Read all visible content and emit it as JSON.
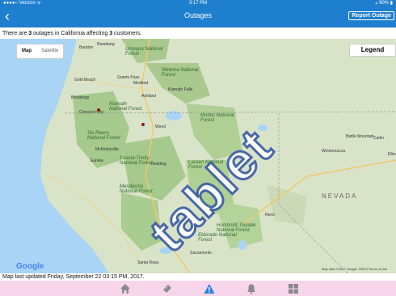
{
  "status": {
    "carrier": "●●●●○ Verizon ᯤ",
    "time": "3:17 PM",
    "battery": "⁎ 90% ▮"
  },
  "nav": {
    "title": "Outages",
    "report_label": "Report Outage"
  },
  "summary": {
    "prefix": "There are ",
    "outages": "3",
    "middle": " outages in California affecting ",
    "customers": "3",
    "suffix": " customers."
  },
  "map": {
    "map_label": "Map",
    "satellite_label": "Satellite",
    "legend_label": "Legend",
    "google_label": "Google",
    "attribution": "Map data ©2017 Google, INEGI   Terms of Use",
    "places": [
      "Roseburg",
      "Bandon",
      "Gold Beach",
      "Grants Pass",
      "Medford",
      "Brookings",
      "Ashland",
      "Klamath Falls",
      "Crescent City",
      "Weed",
      "McKinleyville",
      "Eureka",
      "Redding",
      "Reno",
      "Sacramento",
      "Santa Rosa",
      "Winnemucca",
      "Battle Mountain",
      "Carlin",
      "Elko"
    ],
    "forests": [
      "Umpqua National Forest",
      "Winema National Forest",
      "Klamath National Forest",
      "Six Rivers National Forest",
      "Modoc National Forest",
      "Shasta-Trinity National Forest",
      "Lassen National Forest",
      "Mendocino National Forest",
      "Humboldt-Toiyabe National Forest",
      "Eldorado National Forest",
      "NEVADA"
    ],
    "watermark": "tablet"
  },
  "updated": "Map last updated Friday, September 22 03:15 PM, 2017.",
  "tabs": [
    {
      "icon": "home-icon"
    },
    {
      "icon": "ticket-icon"
    },
    {
      "icon": "warning-icon"
    },
    {
      "icon": "bell-icon"
    },
    {
      "icon": "grid-icon"
    }
  ],
  "colors": {
    "header": "#1f7fcf",
    "tabbar": "#f7d6ec",
    "active_tab": "#2f80e0",
    "marker": "#8b1a1a"
  }
}
